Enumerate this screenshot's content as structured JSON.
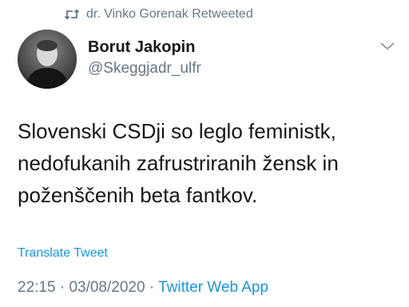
{
  "retweet": {
    "text": "dr. Vinko Gorenak Retweeted",
    "icon": "retweet-icon"
  },
  "author": {
    "name": "Borut Jakopin",
    "handle": "@Skeggjadr_ulfr"
  },
  "tweet": {
    "text": "Slovenski CSDji so leglo feministk,\nnedofukanih zafrustriranih žensk in\npoženščenih beta fantkov.",
    "translate_label": "Translate Tweet"
  },
  "meta": {
    "time": "22:15",
    "separator": "·",
    "date": "03/08/2020",
    "source": "Twitter Web App"
  },
  "colors": {
    "accent": "#1b95e0",
    "muted": "#657786",
    "text": "#14171a"
  }
}
